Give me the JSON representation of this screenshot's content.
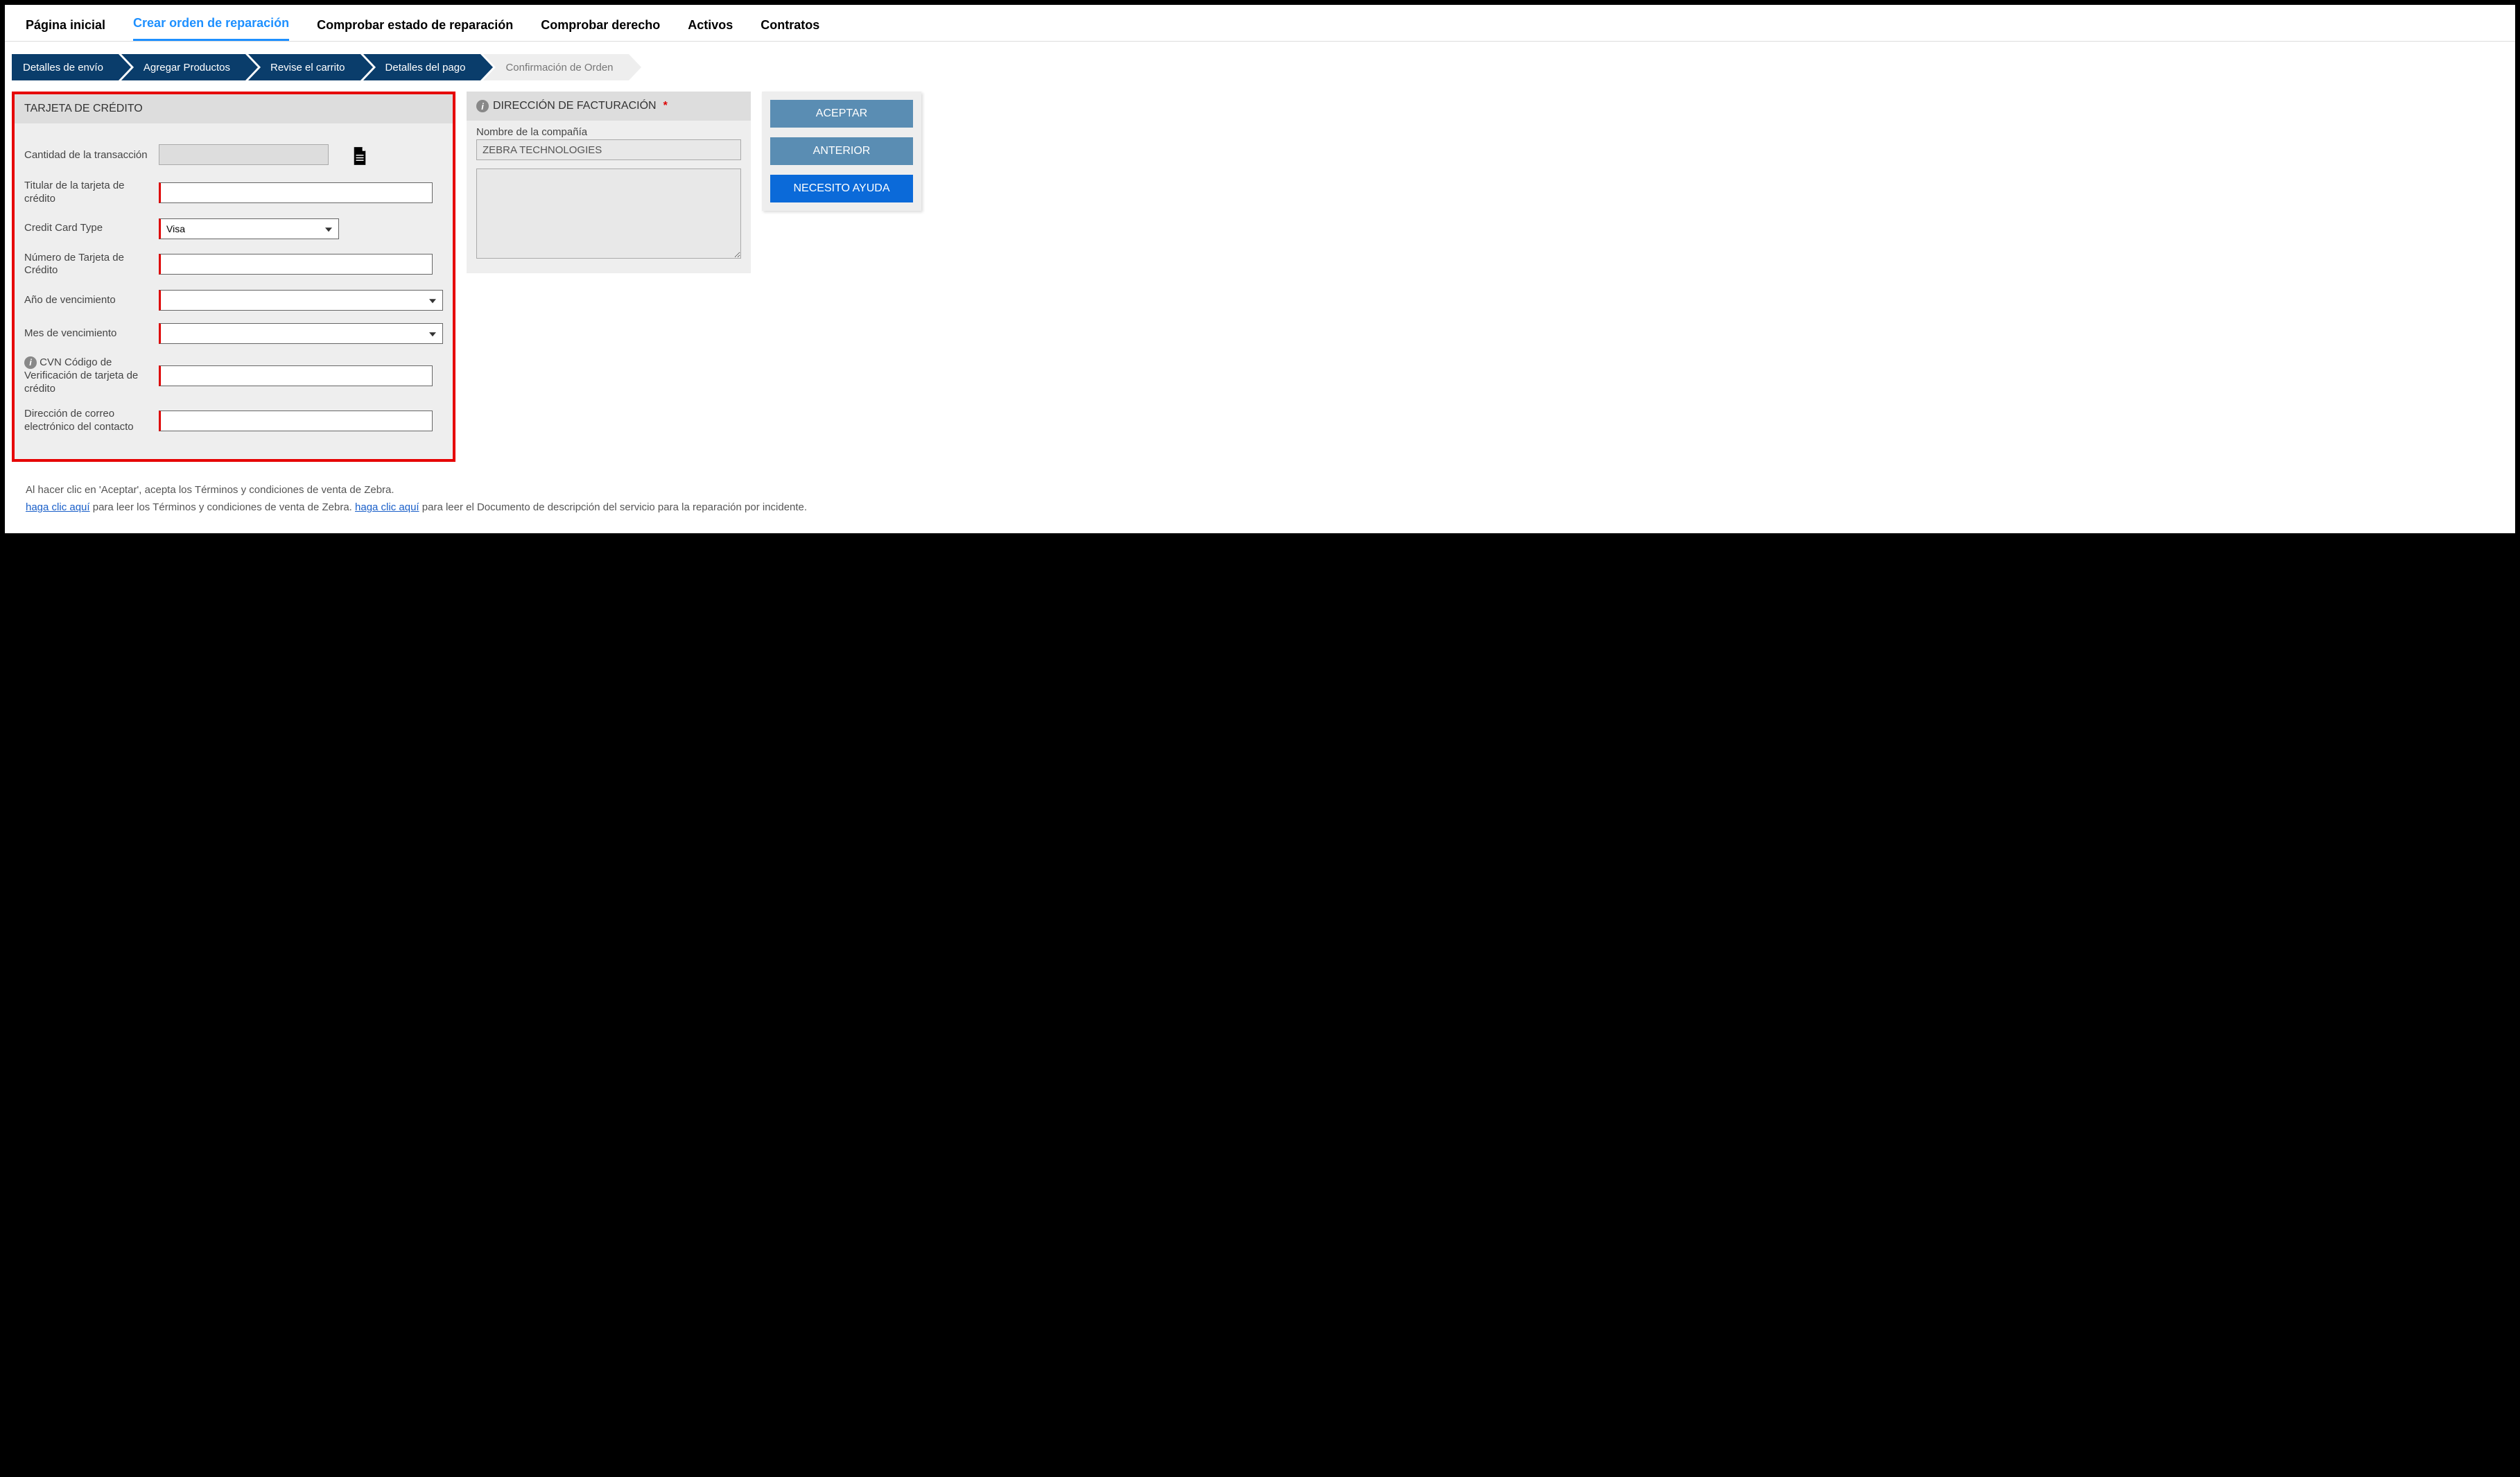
{
  "topnav": {
    "tabs": [
      {
        "label": "Página inicial"
      },
      {
        "label": "Crear orden de reparación"
      },
      {
        "label": "Comprobar estado de reparación"
      },
      {
        "label": "Comprobar derecho"
      },
      {
        "label": "Activos"
      },
      {
        "label": "Contratos"
      }
    ],
    "active_index": 1
  },
  "steps": [
    {
      "label": "Detalles de envío"
    },
    {
      "label": "Agregar Productos"
    },
    {
      "label": "Revise el carrito"
    },
    {
      "label": "Detalles del pago"
    },
    {
      "label": "Confirmación de Orden"
    }
  ],
  "steps_active_upto": 3,
  "cc_panel": {
    "title": "TARJETA DE CRÉDITO",
    "fields": {
      "amount_label": "Cantidad de la transacción",
      "amount_value": "",
      "holder_label": "Titular de la tarjeta de crédito",
      "holder_value": "",
      "type_label": "Credit Card Type",
      "type_value": "Visa",
      "number_label": "Número de Tarjeta de Crédito",
      "number_value": "",
      "year_label": "Año de vencimiento",
      "year_value": "",
      "month_label": "Mes de vencimiento",
      "month_value": "",
      "cvn_label": "CVN Código de Verificación de tarjeta de crédito",
      "cvn_value": "",
      "email_label": "Dirección de correo electrónico del contacto",
      "email_value": ""
    }
  },
  "billing_panel": {
    "title": "DIRECCIÓN DE FACTURACIÓN",
    "company_label": "Nombre de la compañía",
    "company_value": "ZEBRA TECHNOLOGIES",
    "address_value": ""
  },
  "buttons": {
    "accept": "ACEPTAR",
    "previous": "ANTERIOR",
    "help": "NECESITO AYUDA"
  },
  "footer": {
    "line1": "Al hacer clic en 'Aceptar', acepta los Términos y condiciones de venta de Zebra.",
    "link1": "haga clic aquí",
    "line2_mid": " para leer los Términos y condiciones de venta de Zebra. ",
    "link2": " haga clic aquí",
    "line2_end": " para leer el Documento de descripción del servicio para la reparación por incidente."
  }
}
